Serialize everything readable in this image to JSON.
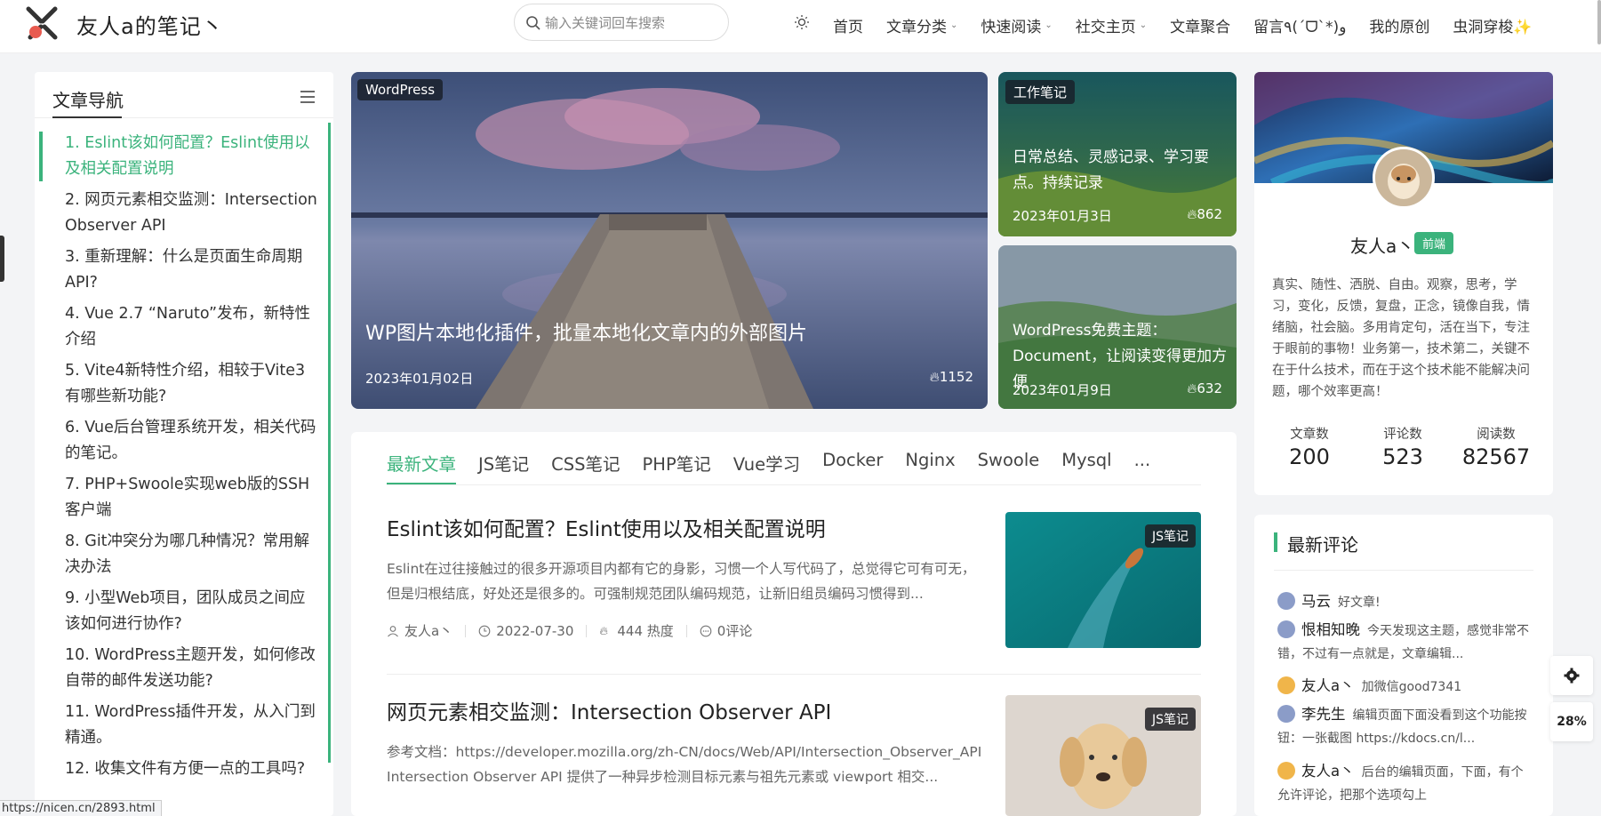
{
  "header": {
    "site_name": "友人a的笔记丶",
    "search_placeholder": "输入关键词回车搜索",
    "nav": [
      {
        "label": "首页",
        "dropdown": false
      },
      {
        "label": "文章分类",
        "dropdown": true
      },
      {
        "label": "快速阅读",
        "dropdown": true
      },
      {
        "label": "社交主页",
        "dropdown": true
      },
      {
        "label": "文章聚合",
        "dropdown": false
      },
      {
        "label": "留言٩(ˊᗜˋ*)و",
        "dropdown": false
      },
      {
        "label": "我的原创",
        "dropdown": false
      },
      {
        "label": "虫洞穿梭✨",
        "dropdown": false
      }
    ]
  },
  "toc": {
    "title": "文章导航",
    "items": [
      "1. Eslint该如何配置？Eslint使用以及相关配置说明",
      "2. 网页元素相交监测：Intersection Observer API",
      "3. 重新理解：什么是页面生命周期API?",
      "4. Vue 2.7 “Naruto”发布，新特性介绍",
      "5. Vite4新特性介绍，相较于Vite3有哪些新功能?",
      "6. Vue后台管理系统开发，相关代码的笔记。",
      "7. PHP+Swoole实现web版的SSH客户端",
      "8. Git冲突分为哪几种情况？常用解决办法",
      "9. 小型Web项目，团队成员之间应该如何进行协作?",
      "10. WordPress主题开发，如何修改自带的邮件发送功能?",
      "11. WordPress插件开发，从入门到精通。",
      "12. 收集文件有方便一点的工具吗?"
    ]
  },
  "hero": {
    "tag": "WordPress",
    "title": "WP图片本地化插件，批量本地化文章内的外部图片",
    "date": "2023年01月02日",
    "views": "1152"
  },
  "side_cards": [
    {
      "tag": "工作笔记",
      "title": "日常总结、灵感记录、学习要点。持续记录",
      "date": "2023年01月3日",
      "views": "862"
    },
    {
      "tag": "",
      "title": "WordPress免费主题：Document，让阅读变得更加方便",
      "date": "2023年01月9日",
      "views": "632"
    }
  ],
  "tabs": [
    "最新文章",
    "JS笔记",
    "CSS笔记",
    "PHP笔记",
    "Vue学习",
    "Docker",
    "Nginx",
    "Swoole",
    "Mysql",
    "..."
  ],
  "posts": [
    {
      "title": "Eslint该如何配置？Eslint使用以及相关配置说明",
      "excerpt": "Eslint在过往接触过的很多开源项目内都有它的身影，习惯一个人写代码了，总觉得它可有可无，但是归根结底，好处还是很多的。可强制规范团队编码规范，让新旧组员编码习惯得到...",
      "author": "友人a丶",
      "date": "2022-07-30",
      "heat": "444 热度",
      "comments": "0评论",
      "tag": "JS笔记"
    },
    {
      "title": "网页元素相交监测：Intersection Observer API",
      "excerpt": "参考文档：https://developer.mozilla.org/zh-CN/docs/Web/API/Intersection_Observer_API Intersection Observer API 提供了一种异步检测目标元素与祖先元素或 viewport 相交...",
      "tag": "JS笔记"
    }
  ],
  "profile": {
    "name": "友人a丶",
    "badge": "前端",
    "bio": "真实、随性、洒脱、自由。观察，思考，学习，变化，反馈，复盘，正念，镜像自我，情绪脑，社会脑。多用肯定句，活在当下，专注于眼前的事物！业务第一，技术第二，关键不在于什么技术，而在于这个技术能不能解决问题，哪个效率更高！",
    "stats": [
      {
        "label": "文章数",
        "value": "200"
      },
      {
        "label": "评论数",
        "value": "523"
      },
      {
        "label": "阅读数",
        "value": "82567"
      }
    ]
  },
  "comments": {
    "title": "最新评论",
    "items": [
      {
        "name": "马云",
        "text": "好文章!"
      },
      {
        "name": "恨相知晚",
        "text": "今天发现这主题，感觉非常不错，不过有一点就是，文章编辑..."
      },
      {
        "name": "友人a丶",
        "text": "加微信good7341"
      },
      {
        "name": "李先生",
        "text": "编辑页面下面没看到这个功能按钮：一张截图 https://kdocs.cn/l..."
      },
      {
        "name": "友人a丶",
        "text": "后台的编辑页面，下面，有个允许评论，把那个选项勾上"
      }
    ]
  },
  "floating": {
    "progress": "28%"
  },
  "status_url": "https://nicen.cn/2893.html"
}
